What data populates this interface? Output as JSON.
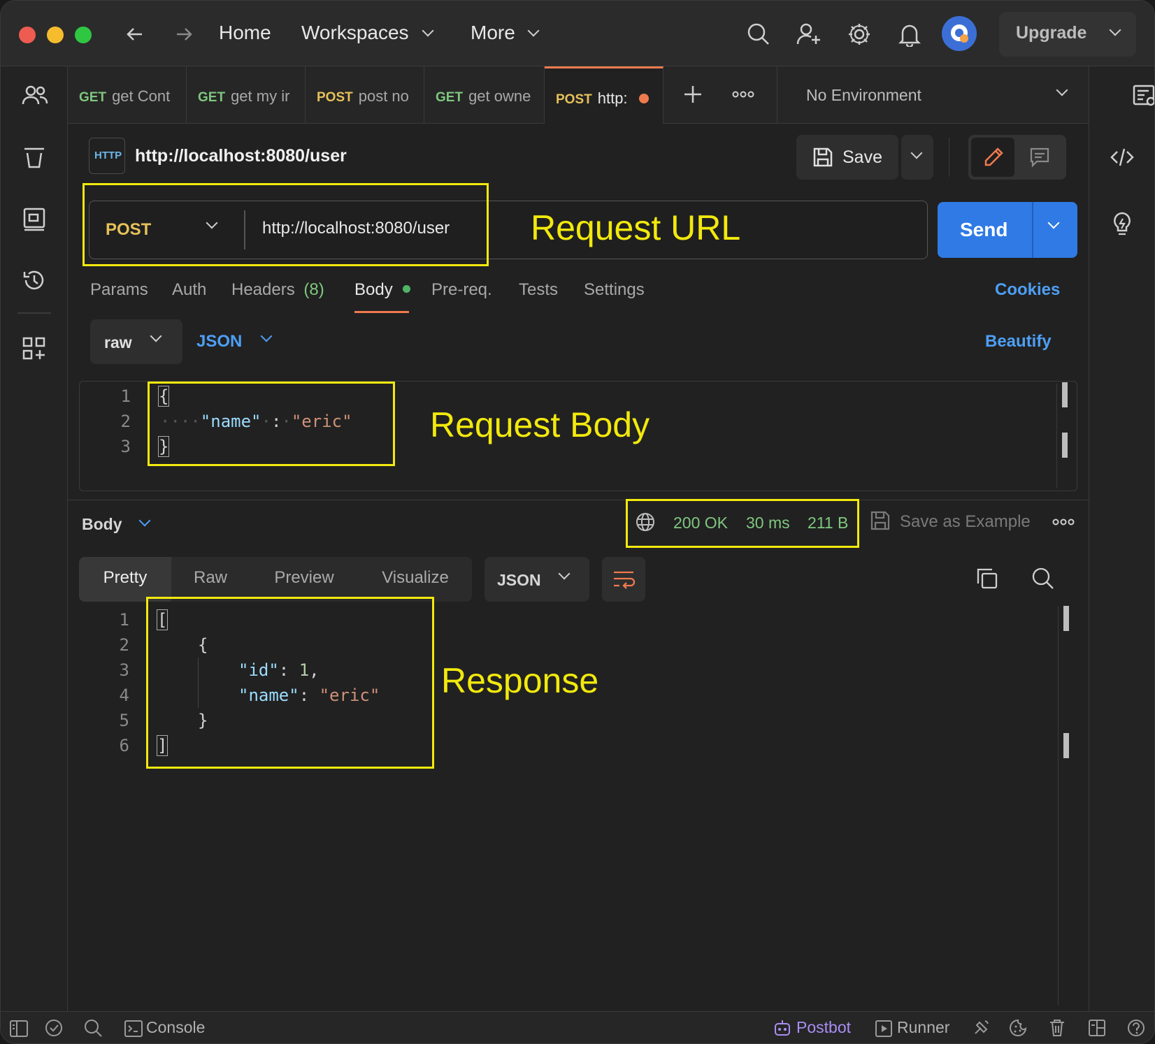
{
  "titlebar": {
    "nav_home": "Home",
    "nav_workspaces": "Workspaces",
    "nav_more": "More",
    "upgrade_label": "Upgrade"
  },
  "tabs": [
    {
      "method": "GET",
      "label": "get Cont"
    },
    {
      "method": "GET",
      "label": "get my ir"
    },
    {
      "method": "POST",
      "label": "post no"
    },
    {
      "method": "GET",
      "label": "get owne"
    },
    {
      "method": "POST",
      "label": "http:"
    }
  ],
  "environment": {
    "selected": "No Environment"
  },
  "request": {
    "http_badge": "HTTP",
    "title": "http://localhost:8080/user",
    "save_label": "Save",
    "method": "POST",
    "url": "http://localhost:8080/user",
    "send_label": "Send"
  },
  "request_tabs": {
    "params": "Params",
    "auth": "Auth",
    "headers": "Headers",
    "headers_count": "(8)",
    "body": "Body",
    "prereq": "Pre-req.",
    "tests": "Tests",
    "settings": "Settings",
    "cookies": "Cookies"
  },
  "body_options": {
    "mode": "raw",
    "format": "JSON",
    "beautify": "Beautify"
  },
  "request_body": {
    "line_numbers": [
      "1",
      "2",
      "3"
    ],
    "open": "{",
    "key": "\"name\"",
    "colon": ":",
    "value": "\"eric\"",
    "close": "}"
  },
  "annotations": {
    "request_url": "Request URL",
    "request_body": "Request Body",
    "response": "Response"
  },
  "response": {
    "section_label": "Body",
    "status": "200 OK",
    "time": "30 ms",
    "size": "211 B",
    "save_example": "Save as Example",
    "view_tabs": [
      "Pretty",
      "Raw",
      "Preview",
      "Visualize"
    ],
    "format": "JSON",
    "line_numbers": [
      "1",
      "2",
      "3",
      "4",
      "5",
      "6"
    ],
    "l1": "[",
    "l2": "{",
    "l3_key": "\"id\"",
    "l3_colon": ": ",
    "l3_val": "1",
    "l3_comma": ",",
    "l4_key": "\"name\"",
    "l4_colon": ": ",
    "l4_val": "\"eric\"",
    "l5": "}",
    "l6": "]"
  },
  "statusbar": {
    "console": "Console",
    "postbot": "Postbot",
    "runner": "Runner"
  },
  "colors": {
    "accent_blue": "#2f7ae5",
    "annotation_yellow": "#f2e90d",
    "status_green": "#7fc77f",
    "tab_indicator": "#ef7a4e"
  }
}
